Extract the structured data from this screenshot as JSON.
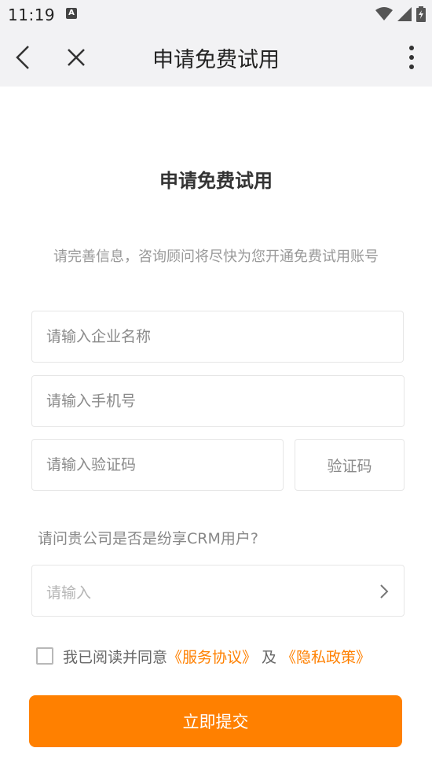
{
  "status_bar": {
    "time": "11:19",
    "notification_icon": "a-icon"
  },
  "nav": {
    "title": "申请免费试用"
  },
  "form": {
    "title": "申请免费试用",
    "subtitle": "请完善信息，咨询顾问将尽快为您开通免费试用账号",
    "company_placeholder": "请输入企业名称",
    "phone_placeholder": "请输入手机号",
    "code_placeholder": "请输入验证码",
    "code_button": "验证码",
    "question": "请问贵公司是否是纷享CRM用户?",
    "select_placeholder": "请输入",
    "agree_prefix": "我已阅读并同意",
    "service_link": "《服务协议》",
    "and": "及",
    "privacy_link": "《隐私政策》",
    "submit": "立即提交"
  },
  "colors": {
    "accent": "#ff8000",
    "bar_bg": "#f2f2f4"
  }
}
